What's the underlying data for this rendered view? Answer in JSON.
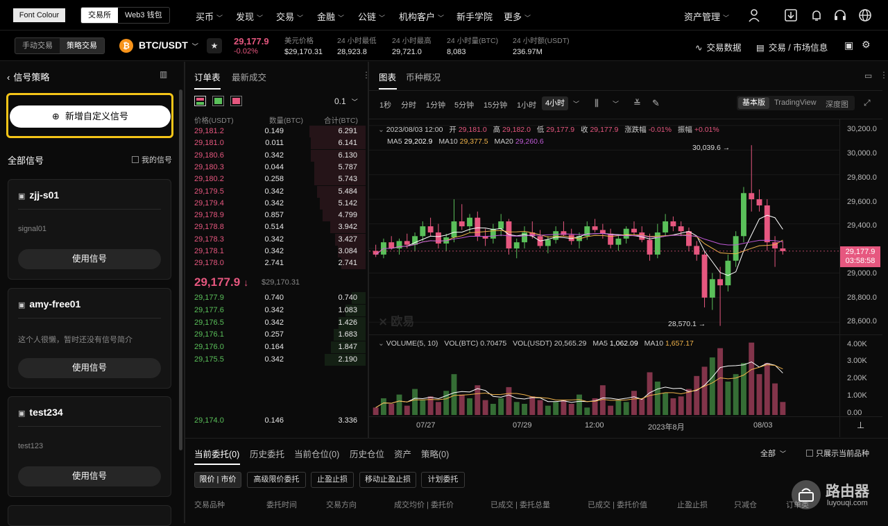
{
  "top": {
    "font_colour": "Font Colour",
    "seg": [
      "交易所",
      "Web3 钱包"
    ],
    "nav": [
      "买币",
      "发现",
      "交易",
      "金融",
      "公链",
      "机构客户",
      "新手学院",
      "更多"
    ],
    "asset": "资产管理"
  },
  "ticker": {
    "mode": [
      "手动交易",
      "策略交易"
    ],
    "pair": "BTC/USDT",
    "price": "29,177.9",
    "change": "-0.02%",
    "stats": [
      {
        "label": "美元价格",
        "value": "$29,170.31"
      },
      {
        "label": "24 小时最低",
        "value": "28,923.8"
      },
      {
        "label": "24 小时最高",
        "value": "29,721.0"
      },
      {
        "label": "24 小时量(BTC)",
        "value": "8,083"
      },
      {
        "label": "24 小时额(USDT)",
        "value": "236.97M"
      }
    ],
    "right": [
      "交易数据",
      "交易 / 市场信息"
    ]
  },
  "left": {
    "title": "信号策略",
    "add": "新增自定义信号",
    "all": "全部信号",
    "mine": "我的信号",
    "cards": [
      {
        "name": "zjj-s01",
        "desc": "signal01",
        "btn": "使用信号"
      },
      {
        "name": "amy-free01",
        "desc": "这个人很懒，暂时还没有信号简介",
        "btn": "使用信号"
      },
      {
        "name": "test234",
        "desc": "test123",
        "btn": "使用信号"
      }
    ]
  },
  "orderbook": {
    "tabs": [
      "订单表",
      "最新成交"
    ],
    "precision": "0.1",
    "headers": [
      "价格(USDT)",
      "数量(BTC)",
      "合计(BTC)"
    ],
    "asks": [
      [
        "29,181.2",
        "0.149",
        "6.291"
      ],
      [
        "29,181.0",
        "0.011",
        "6.141"
      ],
      [
        "29,180.6",
        "0.342",
        "6.130"
      ],
      [
        "29,180.3",
        "0.044",
        "5.787"
      ],
      [
        "29,180.2",
        "0.258",
        "5.743"
      ],
      [
        "29,179.5",
        "0.342",
        "5.484"
      ],
      [
        "29,179.4",
        "0.342",
        "5.142"
      ],
      [
        "29,178.9",
        "0.857",
        "4.799"
      ],
      [
        "29,178.8",
        "0.514",
        "3.942"
      ],
      [
        "29,178.3",
        "0.342",
        "3.427"
      ],
      [
        "29,178.1",
        "0.342",
        "3.084"
      ],
      [
        "29,178.0",
        "2.741",
        "2.741"
      ]
    ],
    "last": "29,177.9",
    "last_usd": "$29,170.31",
    "bids": [
      [
        "29,177.9",
        "0.740",
        "0.740"
      ],
      [
        "29,177.6",
        "0.342",
        "1.083"
      ],
      [
        "29,176.5",
        "0.342",
        "1.426"
      ],
      [
        "29,176.1",
        "0.257",
        "1.683"
      ],
      [
        "29,176.0",
        "0.164",
        "1.847"
      ],
      [
        "29,175.5",
        "0.342",
        "2.190"
      ]
    ],
    "bottom_row": [
      "29,174.0",
      "0.146",
      "3.336"
    ]
  },
  "chart": {
    "tabs": [
      "图表",
      "币种概况"
    ],
    "intervals": [
      "1秒",
      "分时",
      "1分钟",
      "5分钟",
      "15分钟",
      "1小时",
      "4小时"
    ],
    "views": [
      "基本版",
      "TradingView",
      "深度图"
    ],
    "ohlc": "2023/08/03 12:00  开 29,181.0  高 29,182.0  低 29,177.9  收 29,177.9  涨跌幅 -0.01%  振幅 +0.01%",
    "ohlc_parts": {
      "date": "2023/08/03 12:00",
      "o_l": "开",
      "o": "29,181.0",
      "h_l": "高",
      "h": "29,182.0",
      "l_l": "低",
      "l": "29,177.9",
      "c_l": "收",
      "c": "29,177.9",
      "chg_l": "涨跌幅",
      "chg": "-0.01%",
      "amp_l": "振幅",
      "amp": "+0.01%"
    },
    "ma": {
      "ma5_l": "MA5",
      "ma5": "29,202.9",
      "ma10_l": "MA10",
      "ma10": "29,377.5",
      "ma20_l": "MA20",
      "ma20": "29,260.6"
    },
    "high_mark": "30,039.6",
    "low_mark": "28,570.1",
    "watermark": "欧易",
    "price_tag": "29,177.9",
    "countdown": "03:58:58",
    "yaxis": [
      "30,200.0",
      "30,000.0",
      "29,800.0",
      "29,600.0",
      "29,400.0",
      "29,000.0",
      "28,800.0",
      "28,600.0"
    ],
    "vol_line": {
      "label": "VOLUME(5, 10)",
      "vbtc_l": "VOL(BTC)",
      "vbtc": "0.70475",
      "vusdt_l": "VOL(USDT)",
      "vusdt": "20,565.29",
      "ma5_l": "MA5",
      "ma5": "1,062.09",
      "ma10_l": "MA10",
      "ma10": "1,657.17"
    },
    "vol_axis": [
      "4.00K",
      "3.00K",
      "2.00K",
      "1.00K",
      "0.00"
    ],
    "xaxis": [
      "07/27",
      "07/29",
      "12:00",
      "2023年8月",
      "08/03"
    ],
    "colors": {
      "up": "#5ac05a",
      "down": "#e6577f",
      "ma5": "#ffffff",
      "ma10": "#f0b34a",
      "ma20": "#c05ad8"
    }
  },
  "chart_data": {
    "type": "candlestick",
    "ylim": [
      28500,
      30250
    ],
    "candles": [
      [
        29180,
        29230,
        29130,
        29150
      ],
      [
        29150,
        29280,
        29120,
        29250
      ],
      [
        29250,
        29300,
        29190,
        29200
      ],
      [
        29200,
        29280,
        29150,
        29260
      ],
      [
        29260,
        29320,
        29200,
        29230
      ],
      [
        29230,
        29330,
        29180,
        29300
      ],
      [
        29300,
        29420,
        29260,
        29380
      ],
      [
        29380,
        29450,
        29300,
        29330
      ],
      [
        29330,
        29400,
        29200,
        29240
      ],
      [
        29240,
        29320,
        29180,
        29290
      ],
      [
        29290,
        29600,
        29250,
        29420
      ],
      [
        29420,
        29560,
        29350,
        29380
      ],
      [
        29380,
        29480,
        29330,
        29450
      ],
      [
        29450,
        29500,
        29260,
        29300
      ],
      [
        29300,
        29360,
        29220,
        29280
      ],
      [
        29280,
        29400,
        29240,
        29360
      ],
      [
        29360,
        29480,
        29300,
        29420
      ],
      [
        29420,
        29440,
        29150,
        29200
      ],
      [
        29200,
        29280,
        29120,
        29250
      ],
      [
        29250,
        29380,
        29200,
        29330
      ],
      [
        29330,
        29420,
        29280,
        29300
      ],
      [
        29300,
        29350,
        29200,
        29220
      ],
      [
        29220,
        29300,
        29160,
        29270
      ],
      [
        29270,
        29380,
        29240,
        29340
      ],
      [
        29340,
        29420,
        29300,
        29310
      ],
      [
        29310,
        29360,
        29230,
        29260
      ],
      [
        29260,
        29330,
        29200,
        29300
      ],
      [
        29300,
        29420,
        29270,
        29380
      ],
      [
        29380,
        29440,
        29330,
        29350
      ],
      [
        29350,
        29400,
        29280,
        29320
      ],
      [
        29320,
        29360,
        29200,
        29230
      ],
      [
        29230,
        29300,
        29180,
        29280
      ],
      [
        29280,
        29380,
        29240,
        29360
      ],
      [
        29360,
        29420,
        29300,
        29330
      ],
      [
        29330,
        29380,
        29250,
        29270
      ],
      [
        29270,
        29320,
        29100,
        29150
      ],
      [
        29150,
        29400,
        29120,
        29330
      ],
      [
        29330,
        29480,
        29300,
        29420
      ],
      [
        29420,
        29460,
        29340,
        29380
      ],
      [
        29380,
        29420,
        29300,
        29340
      ],
      [
        29340,
        29370,
        29180,
        29220
      ],
      [
        29220,
        29260,
        29100,
        29150
      ],
      [
        29150,
        29180,
        28720,
        28800
      ],
      [
        28800,
        29000,
        28700,
        28950
      ],
      [
        28950,
        29050,
        28570,
        28900
      ],
      [
        28900,
        29150,
        28850,
        29100
      ],
      [
        29100,
        29340,
        29050,
        29300
      ],
      [
        29300,
        29700,
        29250,
        29650
      ],
      [
        29650,
        30040,
        29500,
        29600
      ],
      [
        29600,
        29680,
        29500,
        29550
      ],
      [
        29550,
        29600,
        29180,
        29250
      ],
      [
        29250,
        29300,
        29050,
        29200
      ],
      [
        29200,
        29260,
        29150,
        29178
      ]
    ],
    "volume": [
      400,
      900,
      600,
      1100,
      500,
      1400,
      800,
      1000,
      700,
      1300,
      2200,
      1100,
      900,
      1600,
      800,
      600,
      900,
      1500,
      700,
      600,
      1000,
      800,
      500,
      700,
      800,
      600,
      1100,
      400,
      900,
      1600,
      500,
      800,
      700,
      1300,
      900,
      2300,
      1800,
      1200,
      900,
      1000,
      1400,
      2100,
      2600,
      3100,
      3600,
      1800,
      2200,
      2800,
      3900,
      2200,
      2800,
      1700,
      700
    ]
  },
  "bottom": {
    "tabs": [
      "当前委托(0)",
      "历史委托",
      "当前仓位(0)",
      "历史仓位",
      "资产",
      "策略(0)"
    ],
    "filter": "全部",
    "only_current": "只展示当前品种",
    "order_types": [
      "限价 | 市价",
      "高级限价委托",
      "止盈止损",
      "移动止盈止损",
      "计划委托"
    ],
    "cols": [
      "交易品种",
      "委托时间",
      "交易方向",
      "成交均价 | 委托价",
      "已成交 | 委托总量",
      "已成交 | 委托价值",
      "止盈止损",
      "只减仓",
      "订单类"
    ]
  },
  "watermark_site": {
    "name": "路由器",
    "url": "luyouqi.com"
  }
}
